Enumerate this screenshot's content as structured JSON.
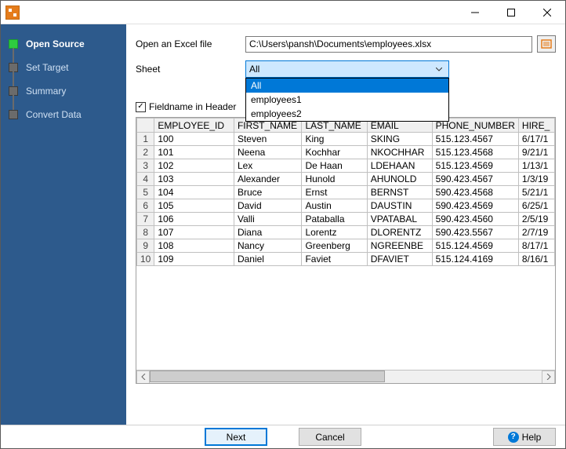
{
  "titlebar": {
    "title": ""
  },
  "sidebar": {
    "steps": [
      {
        "label": "Open Source",
        "active": true
      },
      {
        "label": "Set Target",
        "active": false
      },
      {
        "label": "Summary",
        "active": false
      },
      {
        "label": "Convert Data",
        "active": false
      }
    ]
  },
  "form": {
    "openLabel": "Open an Excel file",
    "filePath": "C:\\Users\\pansh\\Documents\\employees.xlsx",
    "sheetLabel": "Sheet",
    "sheetSelected": "All",
    "sheetOptions": [
      "All",
      "employees1",
      "employees2"
    ],
    "fieldnameLabel": "Fieldname in Header",
    "fieldnameChecked": true
  },
  "table": {
    "columns": [
      "EMPLOYEE_ID",
      "FIRST_NAME",
      "LAST_NAME",
      "EMAIL",
      "PHONE_NUMBER",
      "HIRE_"
    ],
    "rows": [
      [
        "100",
        "Steven",
        "King",
        "SKING",
        "515.123.4567",
        "6/17/1"
      ],
      [
        "101",
        "Neena",
        "Kochhar",
        "NKOCHHAR",
        "515.123.4568",
        "9/21/1"
      ],
      [
        "102",
        "Lex",
        "De Haan",
        "LDEHAAN",
        "515.123.4569",
        "1/13/1"
      ],
      [
        "103",
        "Alexander",
        "Hunold",
        "AHUNOLD",
        "590.423.4567",
        "1/3/19"
      ],
      [
        "104",
        "Bruce",
        "Ernst",
        "BERNST",
        "590.423.4568",
        "5/21/1"
      ],
      [
        "105",
        "David",
        "Austin",
        "DAUSTIN",
        "590.423.4569",
        "6/25/1"
      ],
      [
        "106",
        "Valli",
        "Pataballa",
        "VPATABAL",
        "590.423.4560",
        "2/5/19"
      ],
      [
        "107",
        "Diana",
        "Lorentz",
        "DLORENTZ",
        "590.423.5567",
        "2/7/19"
      ],
      [
        "108",
        "Nancy",
        "Greenberg",
        "NGREENBE",
        "515.124.4569",
        "8/17/1"
      ],
      [
        "109",
        "Daniel",
        "Faviet",
        "DFAVIET",
        "515.124.4169",
        "8/16/1"
      ]
    ]
  },
  "footer": {
    "next": "Next",
    "cancel": "Cancel",
    "help": "Help"
  }
}
